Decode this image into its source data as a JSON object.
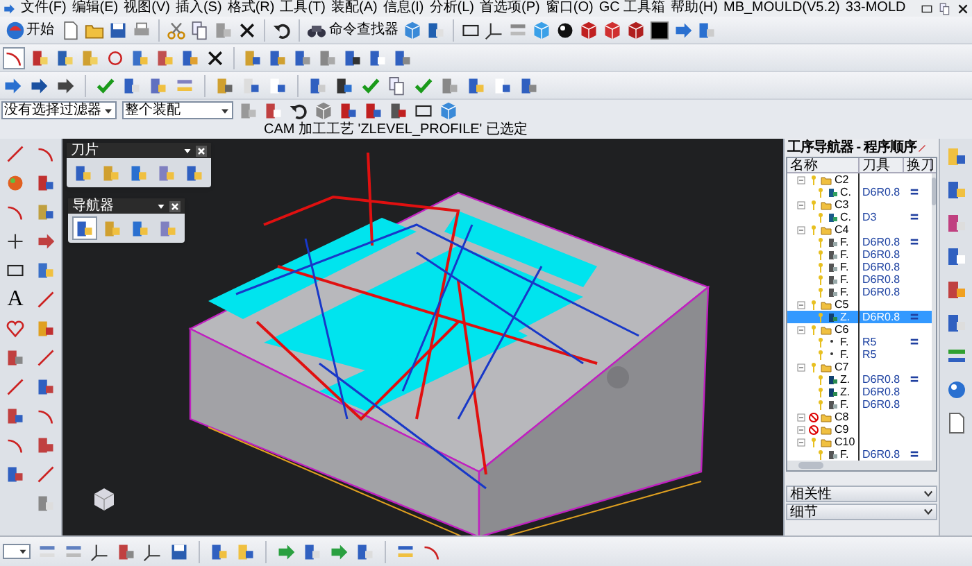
{
  "menu_bar": {
    "items": [
      "文件(F)",
      "编辑(E)",
      "视图(V)",
      "插入(S)",
      "格式(R)",
      "工具(T)",
      "装配(A)",
      "信息(I)",
      "分析(L)",
      "首选项(P)",
      "窗口(O)",
      "GC 工具箱",
      "帮助(H)",
      "MB_MOULD(V5.2)",
      "33-MOLD"
    ]
  },
  "toolbar": {
    "start_button": "开始",
    "command_finder": "命令查找器"
  },
  "selection_bar": {
    "filter": "没有选择过滤器",
    "scope": "整个装配"
  },
  "status_message": "CAM 加工工艺 'ZLEVEL_PROFILE' 已选定",
  "left_toolbar": {
    "text_tool_glyph": "A"
  },
  "palettes": [
    {
      "title": "刀片",
      "buttons": [
        {
          "selected": false
        },
        {
          "selected": false
        },
        {
          "selected": false
        },
        {
          "selected": false
        },
        {
          "selected": false
        }
      ]
    },
    {
      "title": "导航器",
      "buttons": [
        {
          "selected": true
        },
        {
          "selected": false
        },
        {
          "selected": false
        },
        {
          "selected": false
        }
      ]
    }
  ],
  "navigator": {
    "title": "工序导航器 - 程序顺序",
    "columns": [
      "名称",
      "刀具",
      "换刀"
    ],
    "tree": [
      {
        "name": "C2",
        "blocked": false,
        "selected": false,
        "children": [
          {
            "name": "C.",
            "kind": "cavity",
            "tool": "D6R0.8",
            "tool_change": true,
            "selected": false
          }
        ]
      },
      {
        "name": "C3",
        "blocked": false,
        "selected": false,
        "children": [
          {
            "name": "C.",
            "kind": "cavity",
            "tool": "D3",
            "tool_change": true,
            "selected": false
          }
        ]
      },
      {
        "name": "C4",
        "blocked": false,
        "selected": false,
        "children": [
          {
            "name": "F.",
            "kind": "surface",
            "tool": "D6R0.8",
            "tool_change": true,
            "selected": false
          },
          {
            "name": "F.",
            "kind": "surface",
            "tool": "D6R0.8",
            "tool_change": false,
            "selected": false
          },
          {
            "name": "F.",
            "kind": "surface",
            "tool": "D6R0.8",
            "tool_change": false,
            "selected": false
          },
          {
            "name": "F.",
            "kind": "surface",
            "tool": "D6R0.8",
            "tool_change": false,
            "selected": false
          },
          {
            "name": "F.",
            "kind": "surface",
            "tool": "D6R0.8",
            "tool_change": false,
            "selected": false
          }
        ]
      },
      {
        "name": "C5",
        "blocked": false,
        "selected": false,
        "children": [
          {
            "name": "Z.",
            "kind": "zlevel",
            "tool": "D6R0.8",
            "tool_change": true,
            "selected": true
          }
        ]
      },
      {
        "name": "C6",
        "blocked": false,
        "selected": false,
        "children": [
          {
            "name": "F.",
            "kind": "ball",
            "tool": "R5",
            "tool_change": true,
            "selected": false
          },
          {
            "name": "F.",
            "kind": "ball",
            "tool": "R5",
            "tool_change": false,
            "selected": false
          }
        ]
      },
      {
        "name": "C7",
        "blocked": false,
        "selected": false,
        "children": [
          {
            "name": "Z.",
            "kind": "zlevel",
            "tool": "D6R0.8",
            "tool_change": true,
            "selected": false
          },
          {
            "name": "Z.",
            "kind": "zlevel",
            "tool": "D6R0.8",
            "tool_change": false,
            "selected": false
          },
          {
            "name": "F.",
            "kind": "surface",
            "tool": "D6R0.8",
            "tool_change": false,
            "selected": false
          }
        ]
      },
      {
        "name": "C8",
        "blocked": true,
        "selected": false
      },
      {
        "name": "C9",
        "blocked": true,
        "selected": false
      },
      {
        "name": "C10",
        "blocked": false,
        "selected": false,
        "children": [
          {
            "name": "F.",
            "kind": "surface",
            "tool": "D6R0.8",
            "tool_change": true,
            "selected": false
          }
        ]
      }
    ]
  },
  "sections": [
    {
      "title": "相关性"
    },
    {
      "title": "细节"
    }
  ]
}
